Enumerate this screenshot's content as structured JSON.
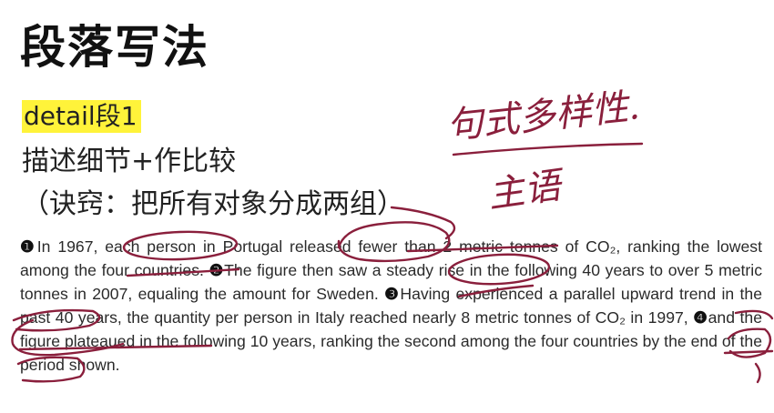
{
  "title": "段落写法",
  "tag": "detail段1",
  "subtitle": "描述细节+作比较",
  "trick": "（诀窍：把所有对象分成两组）",
  "paragraph": {
    "s1_num": "❶",
    "s1": "In 1967, each person in Portugal released fewer than 2 metric tonnes of CO₂, ranking the lowest among the four countries. ",
    "s2_num": "❷",
    "s2": "The figure then saw a steady rise in the following 40 years to over 5 metric tonnes in 2007, equaling the amount for Sweden. ",
    "s3_num": "❸",
    "s3": "Having experienced a parallel upward trend in the past 40 years, the quantity per person in Italy reached nearly 8 metric tonnes of CO₂ in 1997, ",
    "s4_num": "❹",
    "s4": "and the figure plateaued in the following 10 years, ranking the second among the four countries by the end of the period shown."
  },
  "handwriting": {
    "note1": "句式多样性.",
    "note2": "主语"
  },
  "colors": {
    "ink": "#8a1f3c",
    "highlight": "#fff33a"
  }
}
